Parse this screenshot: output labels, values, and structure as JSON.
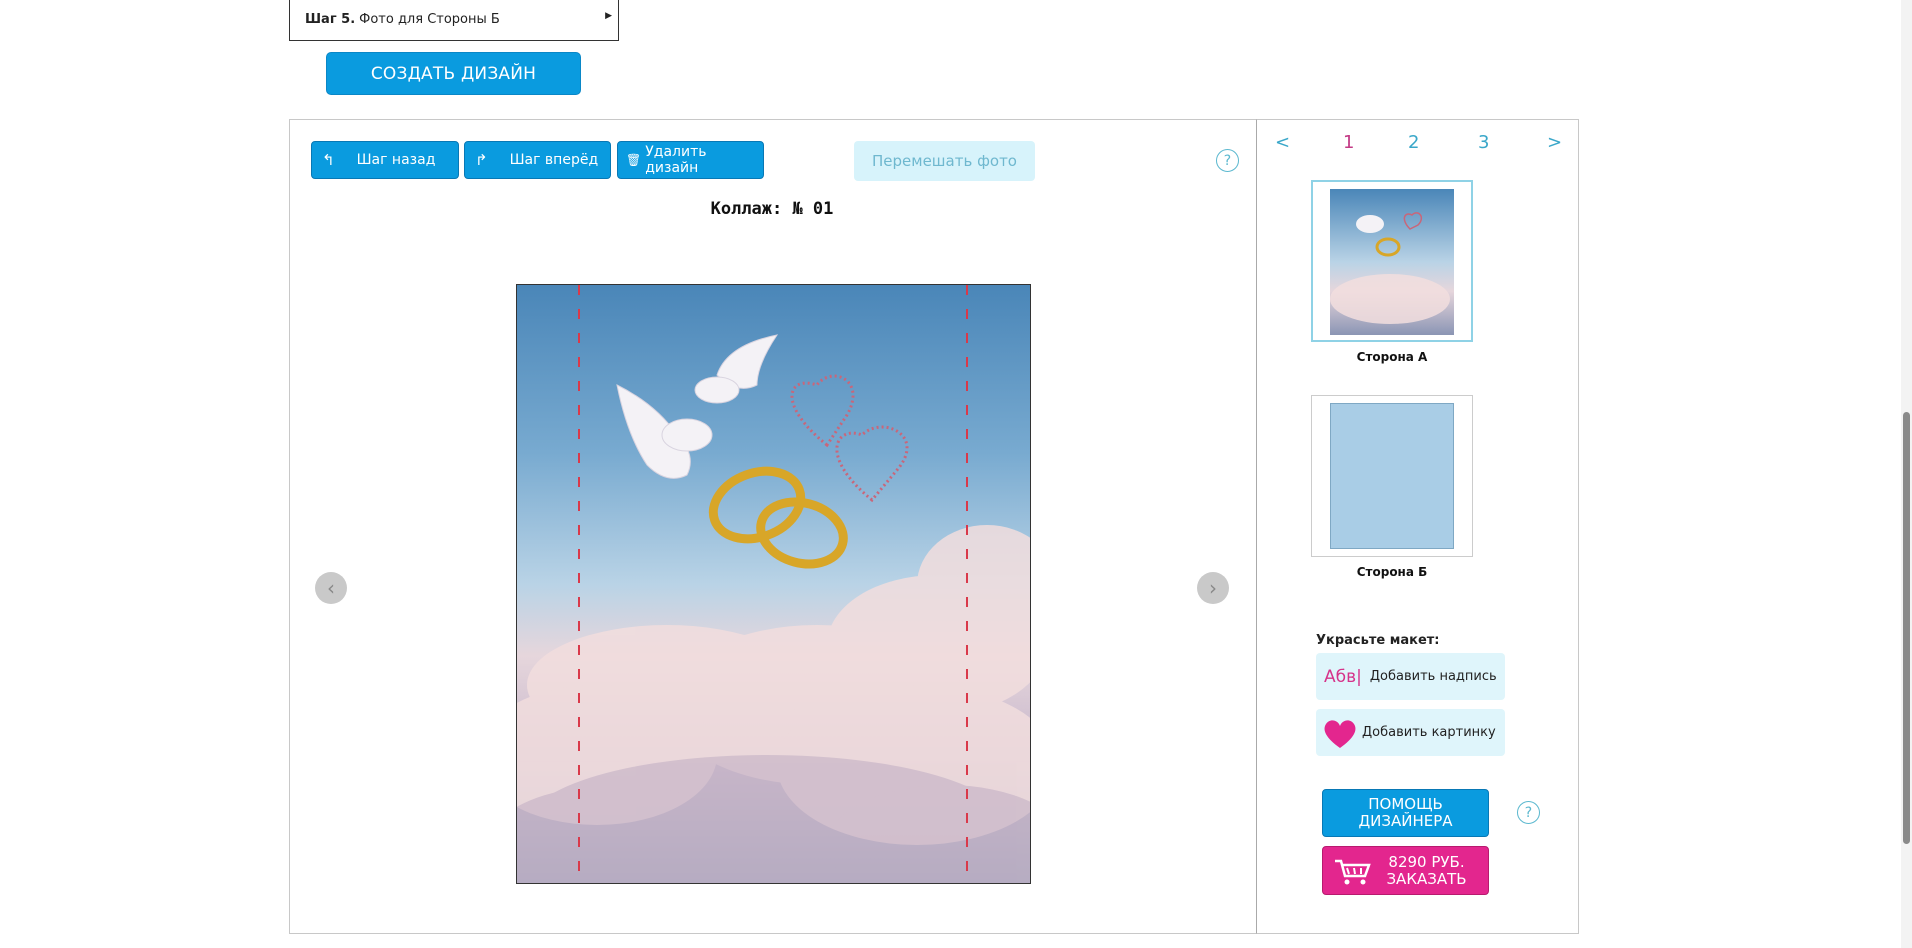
{
  "step": {
    "prefix": "Шаг 5.",
    "label": "Фото для Стороны Б"
  },
  "create_button": "СОЗДАТЬ ДИЗАЙН",
  "toolbar": {
    "back": "Шаг назад",
    "forward": "Шаг вперёд",
    "delete": "Удалить дизайн",
    "shuffle": "Перемешать фото",
    "help": "?"
  },
  "collage_title": "Коллаж: № 01",
  "pager": {
    "prev": "<",
    "pages": [
      "1",
      "2",
      "3"
    ],
    "next": ">",
    "active": "1"
  },
  "sides": [
    {
      "label": "Сторона А"
    },
    {
      "label": "Сторона Б"
    }
  ],
  "decor": {
    "title": "Украсьте макет:",
    "add_text_icon": "Абв|",
    "add_text": "Добавить надпись",
    "add_image": "Добавить картинку"
  },
  "designer_help": {
    "line1": "ПОМОЩЬ",
    "line2": "ДИЗАЙНЕРА",
    "help": "?"
  },
  "order": {
    "price": "8290 РУБ.",
    "label": "ЗАКАЗАТЬ"
  },
  "colors": {
    "accent": "#0a9bdf",
    "order": "#e3268e",
    "light": "#dff5fb"
  }
}
